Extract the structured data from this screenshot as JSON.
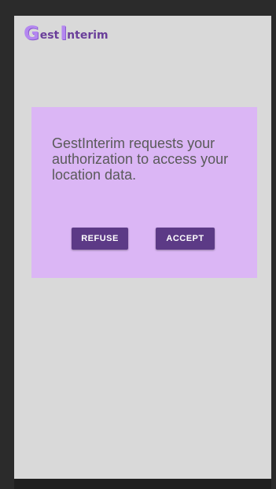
{
  "app": {
    "logo": {
      "g": "G",
      "est": "est",
      "i": "I",
      "nterim": "nterim"
    }
  },
  "dialog": {
    "message": "GestInterim requests your authorization to access your location data.",
    "refuse_label": "REFUSE",
    "accept_label": "ACCEPT"
  },
  "colors": {
    "screen_background": "#d9d9d9",
    "dialog_background": "#dbb6f5",
    "button_background": "#5c3a86",
    "logo_accent": "#b487f0",
    "logo_text": "#6a3f9a"
  }
}
